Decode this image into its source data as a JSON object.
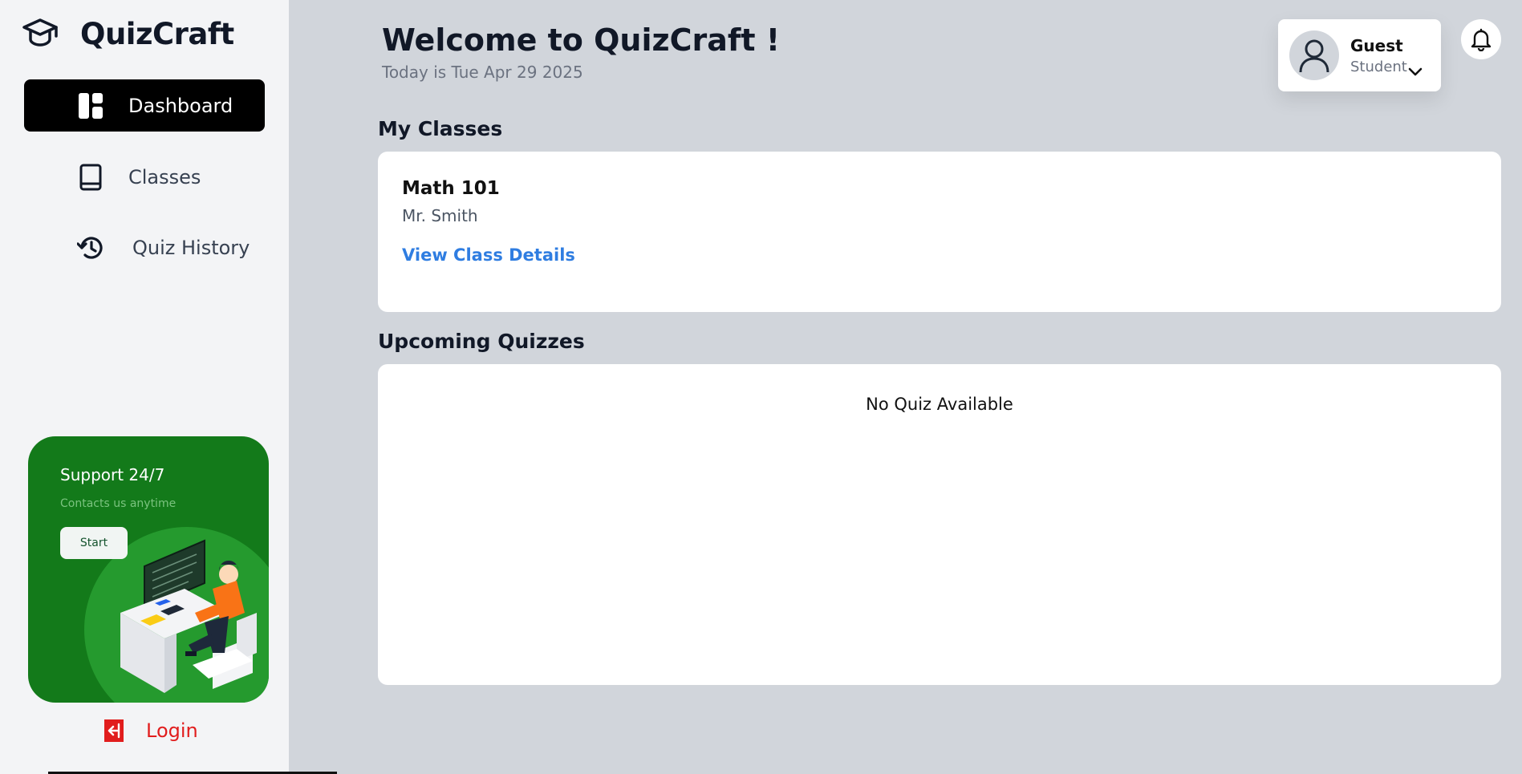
{
  "brand": {
    "name": "QuizCraft",
    "icon": "graduation-cap-icon"
  },
  "sidebar": {
    "items": [
      {
        "label": "Dashboard",
        "icon": "dashboard-icon",
        "active": true
      },
      {
        "label": "Classes",
        "icon": "book-icon",
        "active": false
      },
      {
        "label": "Quiz History",
        "icon": "history-icon",
        "active": false
      }
    ],
    "support": {
      "title": "Support 24/7",
      "subtitle": "Contacts us anytime",
      "button": "Start"
    },
    "login": {
      "label": "Login",
      "icon": "logout-icon"
    }
  },
  "header": {
    "welcome": "Welcome to QuizCraft !",
    "date": "Today is Tue Apr 29 2025"
  },
  "user": {
    "name": "Guest",
    "role": "Student",
    "icon": "user-icon"
  },
  "notifications": {
    "icon": "bell-icon"
  },
  "classes": {
    "title": "My Classes",
    "items": [
      {
        "name": "Math 101",
        "teacher": "Mr. Smith",
        "link": "View Class Details"
      }
    ]
  },
  "quizzes": {
    "title": "Upcoming Quizzes",
    "empty": "No Quiz Available"
  },
  "colors": {
    "sidebar_bg": "#f3f4f6",
    "main_bg": "#d1d5db",
    "active_nav": "#000000",
    "support_green": "#137a1a",
    "link_blue": "#2f7de1",
    "login_red": "#e11d1d"
  }
}
